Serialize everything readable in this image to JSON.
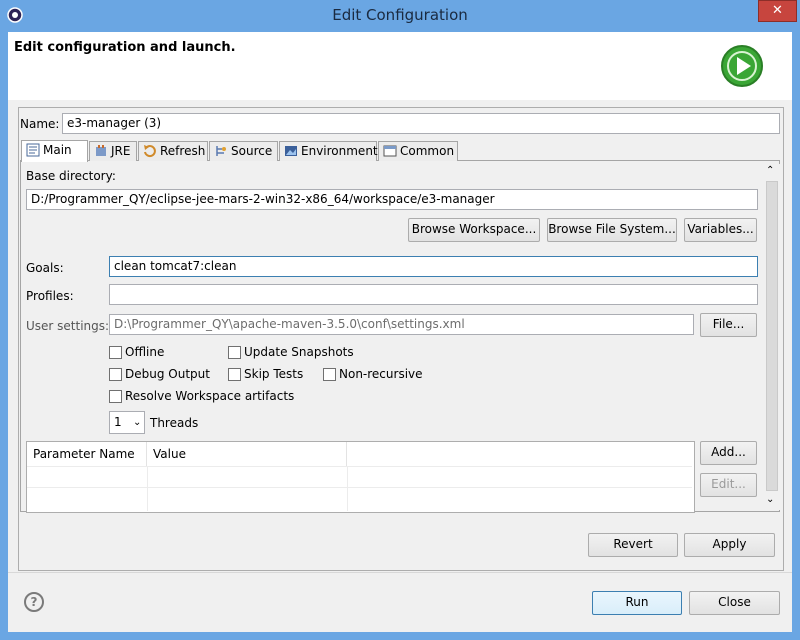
{
  "window": {
    "title": "Edit Configuration",
    "close_glyph": "✕"
  },
  "header": {
    "title": "Edit configuration and launch."
  },
  "name": {
    "label": "Name:",
    "value": "e3-manager (3)"
  },
  "tabs": [
    {
      "label": "Main",
      "icon": "main-tab-icon"
    },
    {
      "label": "JRE",
      "icon": "jre-icon"
    },
    {
      "label": "Refresh",
      "icon": "refresh-icon"
    },
    {
      "label": "Source",
      "icon": "source-icon"
    },
    {
      "label": "Environment",
      "icon": "environment-icon"
    },
    {
      "label": "Common",
      "icon": "common-icon"
    }
  ],
  "main": {
    "base_dir_label": "Base directory:",
    "base_dir_value": "D:/Programmer_QY/eclipse-jee-mars-2-win32-x86_64/workspace/e3-manager",
    "browse_workspace": "Browse Workspace...",
    "browse_fs": "Browse File System...",
    "variables": "Variables...",
    "goals_label": "Goals:",
    "goals_value": "clean tomcat7:clean",
    "profiles_label": "Profiles:",
    "profiles_value": "",
    "user_settings_label": "User settings:",
    "user_settings_value": "D:\\Programmer_QY\\apache-maven-3.5.0\\conf\\settings.xml",
    "file_button": "File...",
    "checkboxes": {
      "offline": "Offline",
      "update_snapshots": "Update Snapshots",
      "debug_output": "Debug Output",
      "skip_tests": "Skip Tests",
      "non_recursive": "Non-recursive",
      "resolve_workspace": "Resolve Workspace artifacts"
    },
    "threads_value": "1",
    "threads_label": "Threads",
    "table": {
      "col1": "Parameter Name",
      "col2": "Value"
    },
    "add_button": "Add...",
    "edit_button": "Edit..."
  },
  "footer": {
    "revert": "Revert",
    "apply": "Apply",
    "run": "Run",
    "close": "Close",
    "help_glyph": "?"
  },
  "colors": {
    "titlebar": "#6aa6e3",
    "close": "#c7453e",
    "run_logo": "#3aa635"
  }
}
